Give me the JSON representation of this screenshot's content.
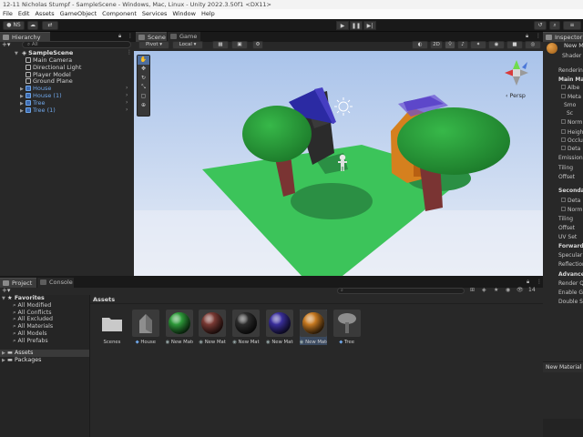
{
  "window": {
    "title": "12-11 Nicholas Stumpf - SampleScene - Windows, Mac, Linux - Unity 2022.3.50f1 <DX11>"
  },
  "menu": [
    "File",
    "Edit",
    "Assets",
    "GameObject",
    "Component",
    "Services",
    "Window",
    "Help"
  ],
  "toolbar": {
    "account_label": "NS",
    "play_icon": "play-icon",
    "pause_icon": "pause-icon",
    "step_icon": "step-icon"
  },
  "hierarchy": {
    "tab_label": "Hierarchy",
    "search_placeholder": "All",
    "scene_name": "SampleScene",
    "items": [
      {
        "label": "Main Camera",
        "prefab": false
      },
      {
        "label": "Directional Light",
        "prefab": false
      },
      {
        "label": "Player Model",
        "prefab": false
      },
      {
        "label": "Ground Plane",
        "prefab": false
      },
      {
        "label": "House",
        "prefab": true
      },
      {
        "label": "House (1)",
        "prefab": true
      },
      {
        "label": "Tree",
        "prefab": true
      },
      {
        "label": "Tree (1)",
        "prefab": true
      }
    ]
  },
  "scene": {
    "tab_scene": "Scene",
    "tab_game": "Game",
    "pivot_label": "Pivot",
    "local_label": "Local",
    "mode_label": "2D",
    "persp_label": "Persp"
  },
  "project": {
    "tab_project": "Project",
    "tab_console": "Console",
    "favorites_label": "Favorites",
    "favorites": [
      "All Modified",
      "All Conflicts",
      "All Excluded",
      "All Materials",
      "All Models",
      "All Prefabs"
    ],
    "assets_label": "Assets",
    "packages_label": "Packages",
    "breadcrumb": "Assets",
    "count_label": "14",
    "assets": [
      {
        "label": "Scenes",
        "kind": "folder",
        "color": "#c9c9c9"
      },
      {
        "label": "House",
        "kind": "prefab",
        "color": "#8e8e8e"
      },
      {
        "label": "New Materi...",
        "kind": "material",
        "color": "#2e9a3a"
      },
      {
        "label": "New Materi...",
        "kind": "material",
        "color": "#7a3a34"
      },
      {
        "label": "New Materi...",
        "kind": "material",
        "color": "#2c2c2c"
      },
      {
        "label": "New Materi...",
        "kind": "material",
        "color": "#3a2f9c"
      },
      {
        "label": "New Materi...",
        "kind": "material",
        "color": "#c77a22"
      },
      {
        "label": "Tree",
        "kind": "prefab",
        "color": "#8e8e8e"
      }
    ]
  },
  "inspector": {
    "tab_label": "Inspector",
    "material_name": "New M",
    "shader_label": "Shader",
    "rows": [
      {
        "label": "Rendering",
        "bold": false,
        "check": false,
        "indent": 0
      },
      {
        "label": "Main Maps",
        "bold": true,
        "check": false,
        "indent": 0
      },
      {
        "label": "Albe",
        "bold": false,
        "check": true,
        "indent": 1
      },
      {
        "label": "Meta",
        "bold": false,
        "check": true,
        "indent": 1
      },
      {
        "label": "Smo",
        "bold": false,
        "check": false,
        "indent": 2
      },
      {
        "label": "Sc",
        "bold": false,
        "check": false,
        "indent": 3
      },
      {
        "label": "Norm",
        "bold": false,
        "check": true,
        "indent": 1
      },
      {
        "label": "Heigh",
        "bold": false,
        "check": true,
        "indent": 1
      },
      {
        "label": "Occlu",
        "bold": false,
        "check": true,
        "indent": 1
      },
      {
        "label": "Deta",
        "bold": false,
        "check": true,
        "indent": 1
      },
      {
        "label": "Emission",
        "bold": false,
        "check": false,
        "indent": 0
      },
      {
        "label": "Tiling",
        "bold": false,
        "check": false,
        "indent": 0
      },
      {
        "label": "Offset",
        "bold": false,
        "check": false,
        "indent": 0
      },
      {
        "label": "Secondar",
        "bold": true,
        "check": false,
        "indent": 0
      },
      {
        "label": "Deta",
        "bold": false,
        "check": true,
        "indent": 1
      },
      {
        "label": "Norm",
        "bold": false,
        "check": true,
        "indent": 1
      },
      {
        "label": "Tiling",
        "bold": false,
        "check": false,
        "indent": 0
      },
      {
        "label": "Offset",
        "bold": false,
        "check": false,
        "indent": 0
      },
      {
        "label": "UV Set",
        "bold": false,
        "check": false,
        "indent": 0
      },
      {
        "label": "Forward R",
        "bold": true,
        "check": false,
        "indent": 0
      },
      {
        "label": "Specular",
        "bold": false,
        "check": false,
        "indent": 0
      },
      {
        "label": "Reflection",
        "bold": false,
        "check": false,
        "indent": 0
      },
      {
        "label": "Advanced",
        "bold": true,
        "check": false,
        "indent": 0
      },
      {
        "label": "Render Qu",
        "bold": false,
        "check": false,
        "indent": 0
      },
      {
        "label": "Enable GP",
        "bold": false,
        "check": false,
        "indent": 0
      },
      {
        "label": "Double Si",
        "bold": false,
        "check": false,
        "indent": 0
      }
    ],
    "footer_label": "New Material"
  },
  "colors": {
    "accent_blue": "#6fa6e8",
    "ground_green": "#3cc45a",
    "sky_top": "#a9c3ea",
    "sky_bottom": "#e9eef7"
  }
}
